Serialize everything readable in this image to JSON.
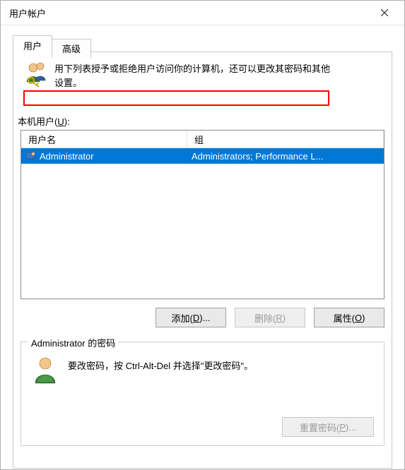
{
  "window": {
    "title": "用户帐户"
  },
  "tabs": {
    "users": "用户",
    "advanced": "高级"
  },
  "header": {
    "line1": "用下列表授予或拒绝用户访问你的计算机，还可以更改其密码和其他",
    "line2": "设置。"
  },
  "list": {
    "label_prefix": "本机用户(",
    "label_mnemonic": "U",
    "label_suffix": "):",
    "columns": {
      "user": "用户名",
      "group": "组"
    },
    "rows": [
      {
        "user": "Administrator",
        "group": "Administrators; Performance L..."
      }
    ]
  },
  "buttons": {
    "add": {
      "text": "添加(",
      "mnem": "D",
      "suffix": ")..."
    },
    "remove": {
      "text": "删除(",
      "mnem": "R",
      "suffix": ")"
    },
    "properties": {
      "text": "属性(",
      "mnem": "O",
      "suffix": ")"
    }
  },
  "password_group": {
    "legend": "Administrator 的密码",
    "text": "要改密码，按 Ctrl-Alt-Del 并选择\"更改密码\"。",
    "reset": {
      "text": "重置密码(",
      "mnem": "P",
      "suffix": ")..."
    }
  }
}
